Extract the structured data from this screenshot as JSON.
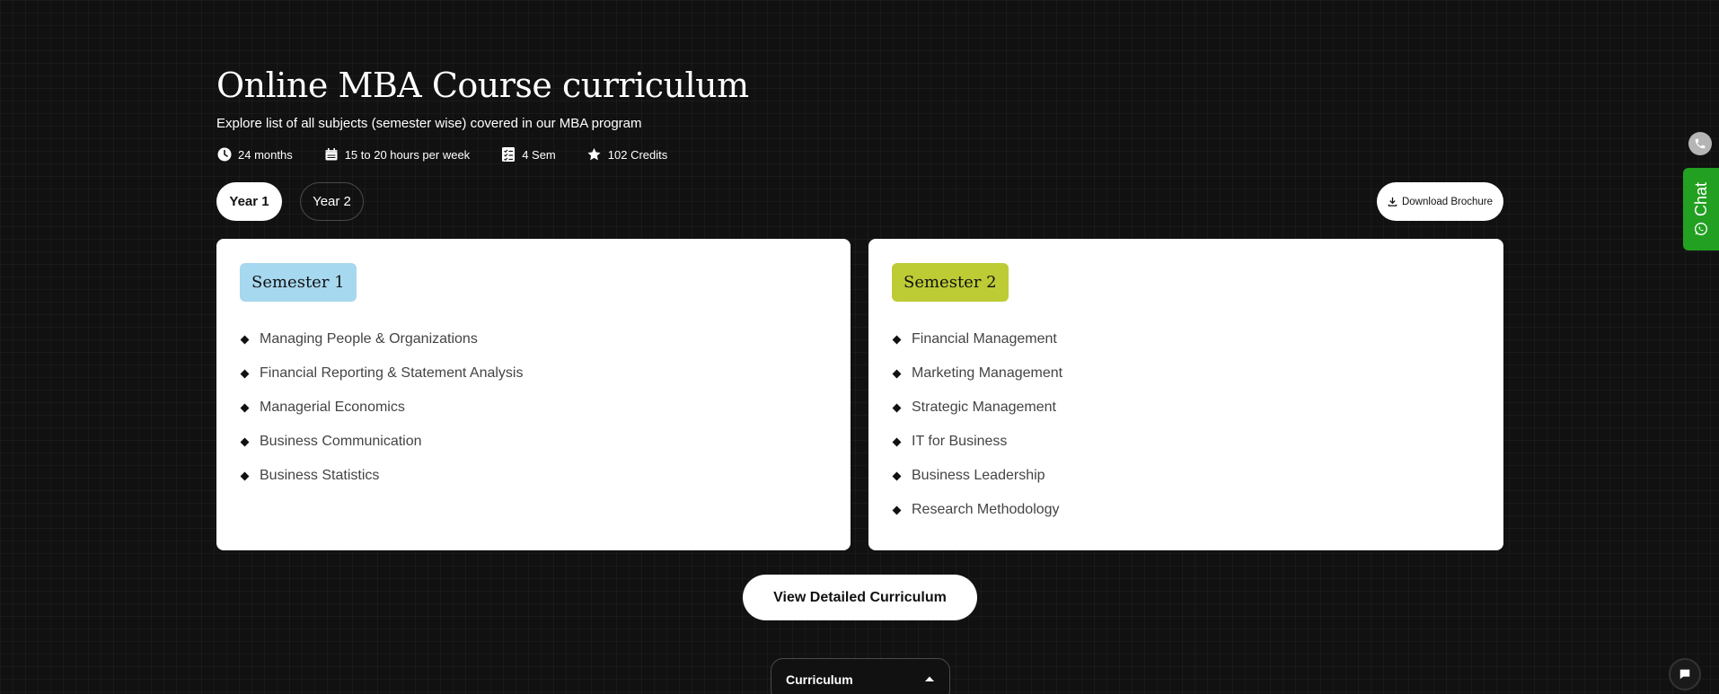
{
  "header": {
    "title": "Online MBA Course curriculum",
    "subtitle": "Explore list of all subjects (semester wise) covered in our MBA program"
  },
  "stats": [
    {
      "icon": "clock-icon",
      "label": "24 months"
    },
    {
      "icon": "calendar-icon",
      "label": "15 to 20 hours per week"
    },
    {
      "icon": "checklist-icon",
      "label": "4 Sem"
    },
    {
      "icon": "star-icon",
      "label": "102 Credits"
    }
  ],
  "tabs": [
    {
      "label": "Year 1",
      "active": true
    },
    {
      "label": "Year 2",
      "active": false
    }
  ],
  "download_label": "Download Brochure",
  "semesters": [
    {
      "label": "Semester 1",
      "color": "#a6d8ef",
      "subjects": [
        "Managing People & Organizations",
        "Financial Reporting & Statement Analysis",
        "Managerial Economics",
        "Business Communication",
        "Business Statistics"
      ]
    },
    {
      "label": "Semester 2",
      "color": "#bdcc35",
      "subjects": [
        "Financial Management",
        "Marketing Management",
        "Strategic Management",
        "IT for Business",
        "Business Leadership",
        "Research Methodology"
      ]
    }
  ],
  "view_curriculum_label": "View Detailed Curriculum",
  "curriculum_bar_label": "Curriculum",
  "side": {
    "chat_label": "Chat",
    "phone_icon": "phone-icon",
    "whatsapp_icon": "whatsapp-icon",
    "message_icon": "message-icon"
  },
  "colors": {
    "background": "#111111",
    "chat_green": "#22a022"
  }
}
